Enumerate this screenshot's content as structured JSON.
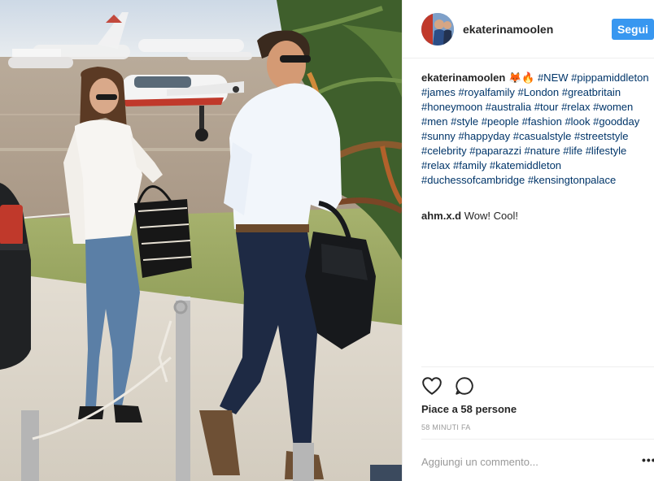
{
  "post": {
    "username": "ekaterinamoolen",
    "follow_label": "Segui",
    "caption_username": "ekaterinamoolen",
    "caption_emoji": "🦊🔥",
    "hashtags": [
      "#NEW",
      "#pippamiddleton",
      "#james",
      "#royalfamily",
      "#London",
      "#greatbritain",
      "#honeymoon",
      "#australia",
      "#tour",
      "#relax",
      "#women",
      "#men",
      "#style",
      "#people",
      "#fashion",
      "#look",
      "#goodday",
      "#sunny",
      "#happyday",
      "#casualstyle",
      "#streetstyle",
      "#celebrity",
      "#paparazzi",
      "#nature",
      "#life",
      "#lifestyle",
      "#relax",
      "#family",
      "#katemiddleton",
      "#duchessofcambridge",
      "#kensingtonpalace"
    ],
    "comment_user": "ahm.x.d",
    "comment_text": "Wow! Cool!",
    "likes_text": "Piace a 58 persone",
    "time_text": "58 MINUTI FA",
    "comment_placeholder": "Aggiungi un commento...",
    "more_label": "•••"
  },
  "icons": {
    "like": "heart-icon",
    "comment": "comment-bubble-icon",
    "more": "more-options-icon"
  },
  "colors": {
    "follow_button": "#3897f0",
    "hashtag": "#003569",
    "muted": "#999999",
    "text": "#262626"
  }
}
